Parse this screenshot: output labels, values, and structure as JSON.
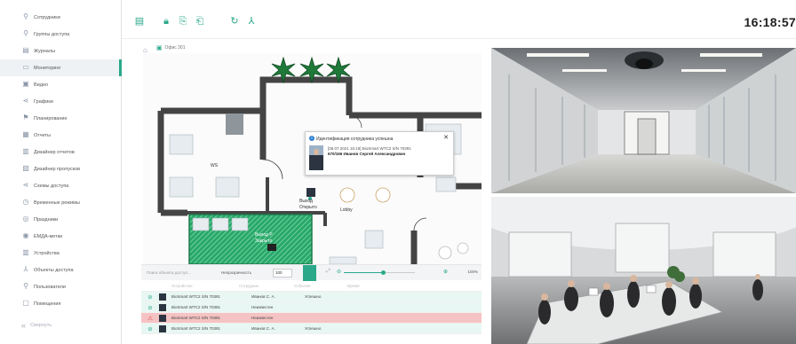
{
  "sidebar": {
    "items": [
      {
        "label": "Сотрудники",
        "icon": "person-icon"
      },
      {
        "label": "Группы доступа",
        "icon": "group-icon"
      },
      {
        "label": "Журналы",
        "icon": "journal-icon"
      },
      {
        "label": "Мониторинг",
        "icon": "monitor-icon",
        "active": true
      },
      {
        "label": "Видео",
        "icon": "video-icon"
      },
      {
        "label": "Графики",
        "icon": "graph-icon"
      },
      {
        "label": "Планирование",
        "icon": "planning-icon"
      },
      {
        "label": "Отчеты",
        "icon": "report-icon"
      },
      {
        "label": "Дизайнер отчетов",
        "icon": "report-designer-icon"
      },
      {
        "label": "Дизайнер пропусков",
        "icon": "pass-designer-icon"
      },
      {
        "label": "Схемы доступа",
        "icon": "schema-icon"
      },
      {
        "label": "Временные режимы",
        "icon": "clock-icon"
      },
      {
        "label": "Праздники",
        "icon": "holiday-icon"
      },
      {
        "label": "ЕМДА-метки",
        "icon": "tag-icon"
      },
      {
        "label": "Устройства",
        "icon": "device-icon"
      },
      {
        "label": "Объекты доступа",
        "icon": "access-object-icon"
      },
      {
        "label": "Пользователи",
        "icon": "users-icon"
      },
      {
        "label": "Помещения",
        "icon": "room-icon"
      }
    ],
    "collapse_label": "Свернуть"
  },
  "toolbar": {
    "clock": "16:18:57"
  },
  "plan": {
    "tab_label": "Офис 301",
    "room_label_ws": "WS",
    "room_label_lobby": "Lobby",
    "device_label_1": "Выход P",
    "device_label_1b": "Закрыто",
    "device_label_2": "Выход",
    "device_label_2b": "Открыто"
  },
  "popup": {
    "title": "Идентификация сотрудника успешна",
    "line1": "[08.07.2021 16:18] BioSmart WTC2 S/N 70391",
    "line2": "670/166 Иванов Сергей Александрович"
  },
  "filter": {
    "search_placeholder": "Поиск объекта доступ...",
    "visibility_label": "Непрозрачность",
    "visibility_value": "100",
    "zoom_value": "100%",
    "zoom_level": 0.55
  },
  "events": {
    "headers": [
      "Устройство",
      "Сотрудник",
      "Событие",
      "Время"
    ],
    "rows": [
      {
        "status": "ok",
        "device": "BioSmart WTC2 S/N 70391",
        "employee": "Иванов С. А.",
        "event": "Успешно"
      },
      {
        "status": "ok",
        "device": "BioSmart WTC2 S/N 70391",
        "employee": "Неизвестен",
        "event": ""
      },
      {
        "status": "alarm",
        "device": "BioSmart WTC2 S/N 70391",
        "employee": "Неизвестен",
        "event": ""
      },
      {
        "status": "ok",
        "device": "BioSmart WTC2 S/N 70391",
        "employee": "Иванов С. А.",
        "event": "Успешно"
      }
    ]
  },
  "colors": {
    "accent": "#2aa88a",
    "alarm_row": "#f5c3c3",
    "ok_row": "#e8f7f3",
    "info": "#2d7fd4"
  }
}
